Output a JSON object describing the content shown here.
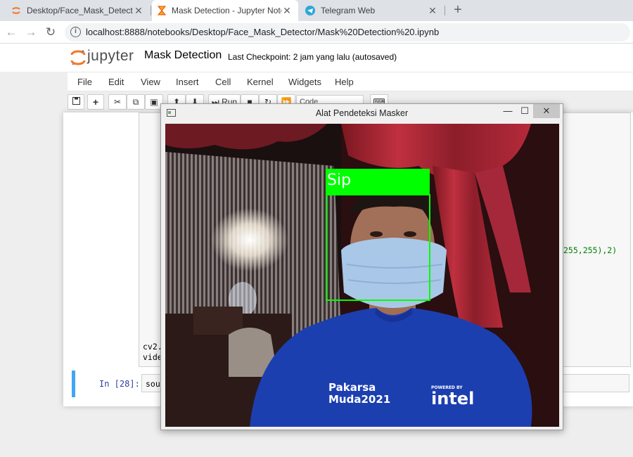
{
  "browser": {
    "tabs": [
      {
        "title": "Desktop/Face_Mask_Detector/",
        "icon": "jupyter-favicon-icon",
        "active": false
      },
      {
        "title": "Mask Detection - Jupyter Notebo",
        "icon": "hourglass-icon",
        "active": true
      },
      {
        "title": "Telegram Web",
        "icon": "telegram-icon",
        "active": false
      }
    ],
    "new_tab": "+",
    "url": "localhost:8888/notebooks/Desktop/Face_Mask_Detector/Mask%20Detection%20.ipynb"
  },
  "jupyter": {
    "logo_text": "jupyter",
    "notebook_title": "Mask Detection",
    "checkpoint": "Last Checkpoint: 2 jam yang lalu  (autosaved)",
    "menu": [
      "File",
      "Edit",
      "View",
      "Insert",
      "Cell",
      "Kernel",
      "Widgets",
      "Help"
    ],
    "toolbar": {
      "run_label": "Run",
      "cell_type": "Code"
    },
    "code_fragments": {
      "line1": "cv2.",
      "line2": "vide",
      "right_fragment": "255,255),2)"
    },
    "cell2": {
      "prompt": "In [28]:",
      "code": "sour"
    }
  },
  "cv_window": {
    "title": "Alat Pendeteksi Masker",
    "detection": {
      "label": "Sip",
      "box_color": "#00ff00"
    },
    "shirt_text": [
      "Pakarsa",
      "Muda2021",
      "POWERED BY",
      "intel"
    ]
  }
}
